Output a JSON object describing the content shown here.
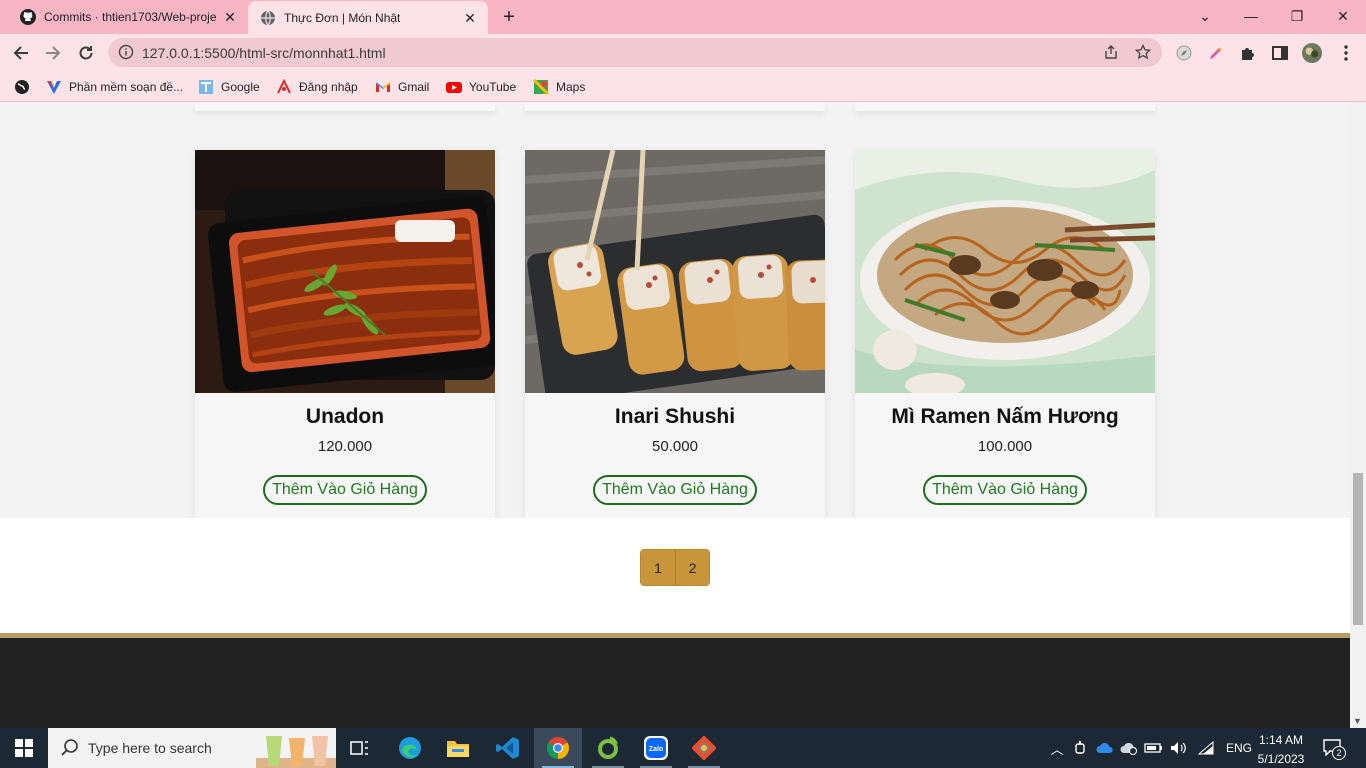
{
  "browser": {
    "tabs": [
      {
        "title": "Commits · thtien1703/Web-proje",
        "icon": "github-icon"
      },
      {
        "title": "Thực Đơn | Món Nhật",
        "icon": "globe-icon"
      }
    ],
    "url": "127.0.0.1:5500/html-src/monnhat1.html",
    "bookmarks": [
      {
        "label": "",
        "icon": "world-icon"
      },
      {
        "label": "Phần mềm soạn đề...",
        "icon": "v-logo-icon"
      },
      {
        "label": "Google",
        "icon": "google-icon"
      },
      {
        "label": "Đăng nhập",
        "icon": "login-icon"
      },
      {
        "label": "Gmail",
        "icon": "gmail-icon"
      },
      {
        "label": "YouTube",
        "icon": "youtube-icon"
      },
      {
        "label": "Maps",
        "icon": "maps-icon"
      }
    ]
  },
  "products": [
    {
      "name": "Unadon",
      "price": "120.000",
      "button": "Thêm Vào Giỏ Hàng"
    },
    {
      "name": "Inari Shushi",
      "price": "50.000",
      "button": "Thêm Vào Giỏ Hàng"
    },
    {
      "name": "Mì Ramen Nấm Hương",
      "price": "100.000",
      "button": "Thêm Vào Giỏ Hàng"
    }
  ],
  "pagination": {
    "pages": [
      "1",
      "2"
    ]
  },
  "taskbar": {
    "search_placeholder": "Type here to search",
    "language": "ENG",
    "time": "1:14 AM",
    "date": "5/1/2023",
    "notifications": "2"
  },
  "colors": {
    "accent_gold": "#c8953a",
    "button_green": "#1e6b1e",
    "footer": "#212121",
    "chrome_pink": "#f8b6c4"
  }
}
